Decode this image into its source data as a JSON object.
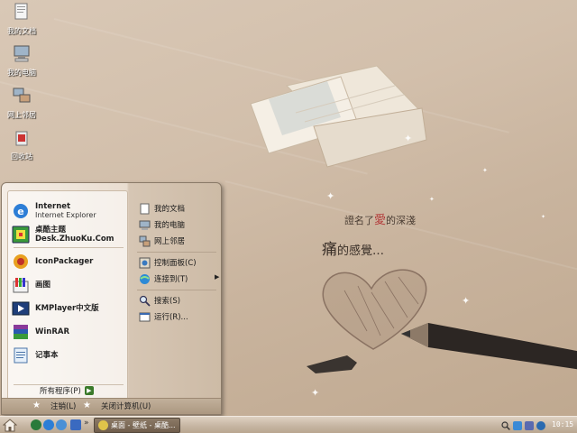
{
  "desktop": {
    "icons": [
      {
        "label": "我的文档",
        "icon": "my-documents-icon"
      },
      {
        "label": "我的电脑",
        "icon": "my-computer-icon"
      },
      {
        "label": "网上邻居",
        "icon": "network-places-icon"
      },
      {
        "label": "回收站",
        "icon": "recycle-bin-icon"
      }
    ],
    "wallpaper_text": {
      "line1_a": "證名了",
      "line1_b": "愛",
      "line1_c": "的深淺",
      "line2_a": "痛",
      "line2_b": "的感覺…"
    }
  },
  "start_menu": {
    "pinned": [
      {
        "title": "Internet",
        "subtitle": "Internet Explorer",
        "icon": "internet-explorer-icon"
      },
      {
        "title": "桌酷主题",
        "subtitle": "Desk.ZhuoKu.Com",
        "icon": "zhuoku-theme-icon"
      }
    ],
    "recent": [
      {
        "title": "IconPackager",
        "icon": "iconpackager-icon"
      },
      {
        "title": "画图",
        "icon": "paint-icon"
      },
      {
        "title": "KMPlayer中文版",
        "icon": "kmplayer-icon"
      },
      {
        "title": "WinRAR",
        "icon": "winrar-icon"
      },
      {
        "title": "记事本",
        "icon": "notepad-icon"
      }
    ],
    "all_programs": "所有程序(P)",
    "right": [
      {
        "label": "我的文档",
        "icon": "my-documents-icon"
      },
      {
        "label": "我的电脑",
        "icon": "my-computer-icon"
      },
      {
        "label": "网上邻居",
        "icon": "network-places-icon"
      },
      {
        "label": "控制面板(C)",
        "icon": "control-panel-icon"
      },
      {
        "label": "连接到(T)",
        "icon": "connect-to-icon"
      },
      {
        "label": "搜索(S)",
        "icon": "search-icon"
      },
      {
        "label": "运行(R)...",
        "icon": "run-icon"
      }
    ],
    "logoff": "注销(L)",
    "shutdown": "关闭计算机(U)"
  },
  "taskbar": {
    "quicklaunch_more": "»",
    "task_label": "桌面 - 壁纸 - 桌酷...",
    "clock": "10:15"
  },
  "colors": {
    "accent": "#8c7a67",
    "menu_bg": "#f4ede5",
    "wallpaper": "#d2bfab"
  }
}
